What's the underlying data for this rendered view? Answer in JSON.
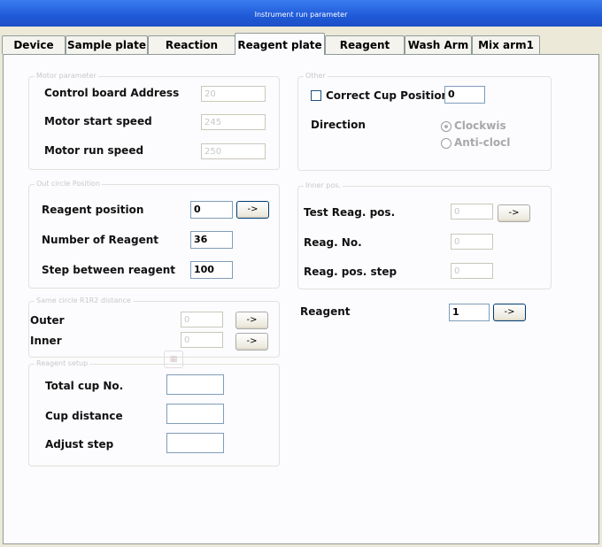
{
  "window": {
    "title": "Instrument run parameter"
  },
  "tabs": [
    "Device",
    "Sample plate",
    "Reaction plate",
    "Reagent plate",
    "Reagent Arm",
    "Wash Arm",
    "Mix arm1"
  ],
  "arrow": "->",
  "motor": {
    "legend": "Motor parameter",
    "control_board_label": "Control board Address",
    "control_board_value": "20",
    "start_speed_label": "Motor start speed",
    "start_speed_value": "245",
    "run_speed_label": "Motor run speed",
    "run_speed_value": "250"
  },
  "other": {
    "legend": "Other",
    "correct_cup_label": "Correct Cup Position",
    "correct_cup_value": "0",
    "direction_label": "Direction",
    "clockwise_label": "Clockwis",
    "anticlock_label": "Anti-clocl"
  },
  "out_circle": {
    "legend": "Out circle Position",
    "reagent_position_label": "Reagent position",
    "reagent_position_value": "0",
    "number_reagent_label": "Number of Reagent",
    "number_reagent_value": "36",
    "step_label": "Step between reagent",
    "step_value": "100"
  },
  "inner": {
    "legend": "Inner pos.",
    "test_label": "Test Reag. pos.",
    "test_value": "0",
    "reag_no_label": "Reag. No.",
    "reag_no_value": "0",
    "reag_step_label": "Reag. pos. step",
    "reag_step_value": "0"
  },
  "same_circle": {
    "legend": "Same circle R1R2 distance",
    "outer_label": "Outer",
    "outer_value": "0",
    "inner_label": "Inner",
    "inner_value": "0"
  },
  "reagent": {
    "label": "Reagent",
    "value": "1"
  },
  "reagent_setup": {
    "legend": "Reagent setup",
    "total_cup_label": "Total cup No.",
    "total_cup_value": "",
    "cup_distance_label": "Cup distance",
    "cup_distance_value": "",
    "adjust_step_label": "Adjust step",
    "adjust_step_value": ""
  }
}
